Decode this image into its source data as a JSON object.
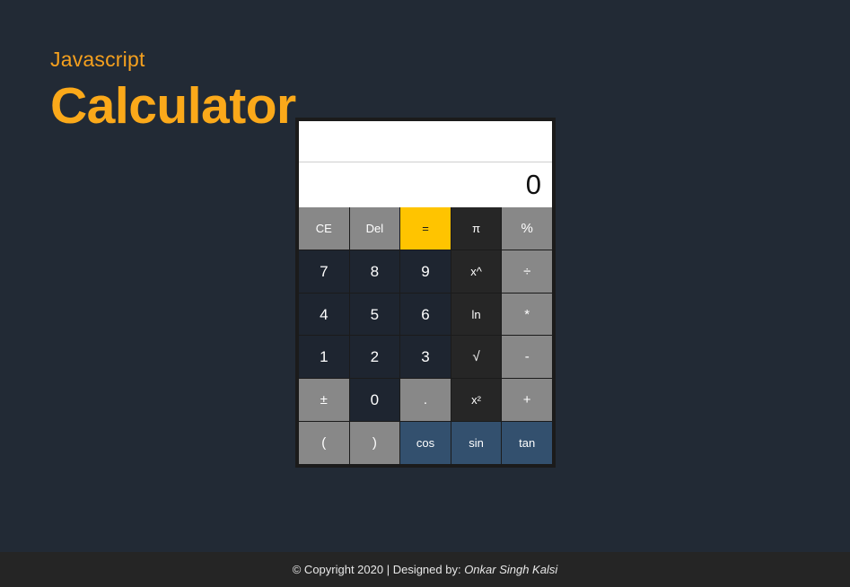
{
  "page": {
    "background_color": "#222a35",
    "subtitle": "Javascript",
    "title": "Calculator",
    "accent_color": "#fba91a"
  },
  "calculator": {
    "display": {
      "expression": "",
      "expression_placeholder": "",
      "result": "0",
      "result_placeholder": "0"
    },
    "colors": {
      "gray": "#888888",
      "yellow": "#ffc400",
      "black": "#262626",
      "navy": "#1e2530",
      "blue": "#33506e"
    },
    "keys": [
      {
        "label": "CE",
        "name": "key-clear-entry",
        "style": "k-gray",
        "size": "small"
      },
      {
        "label": "Del",
        "name": "key-delete",
        "style": "k-gray",
        "size": "small"
      },
      {
        "label": "=",
        "name": "key-equals",
        "style": "k-yellow",
        "size": "small"
      },
      {
        "label": "π",
        "name": "key-pi",
        "style": "k-black",
        "size": "small"
      },
      {
        "label": "%",
        "name": "key-percent",
        "style": "k-gray",
        "size": ""
      },
      {
        "label": "7",
        "name": "key-7",
        "style": "k-navy",
        "size": "num"
      },
      {
        "label": "8",
        "name": "key-8",
        "style": "k-navy",
        "size": "num"
      },
      {
        "label": "9",
        "name": "key-9",
        "style": "k-navy",
        "size": "num"
      },
      {
        "label": "x^",
        "name": "key-power",
        "style": "k-black",
        "size": "small"
      },
      {
        "label": "÷",
        "name": "key-divide",
        "style": "k-gray",
        "size": ""
      },
      {
        "label": "4",
        "name": "key-4",
        "style": "k-navy",
        "size": "num"
      },
      {
        "label": "5",
        "name": "key-5",
        "style": "k-navy",
        "size": "num"
      },
      {
        "label": "6",
        "name": "key-6",
        "style": "k-navy",
        "size": "num"
      },
      {
        "label": "ln",
        "name": "key-natural-log",
        "style": "k-black",
        "size": "small"
      },
      {
        "label": "*",
        "name": "key-multiply",
        "style": "k-gray",
        "size": ""
      },
      {
        "label": "1",
        "name": "key-1",
        "style": "k-navy",
        "size": "num"
      },
      {
        "label": "2",
        "name": "key-2",
        "style": "k-navy",
        "size": "num"
      },
      {
        "label": "3",
        "name": "key-3",
        "style": "k-navy",
        "size": "num"
      },
      {
        "label": "√",
        "name": "key-square-root",
        "style": "k-black",
        "size": ""
      },
      {
        "label": "-",
        "name": "key-subtract",
        "style": "k-gray",
        "size": ""
      },
      {
        "label": "±",
        "name": "key-sign-toggle",
        "style": "k-gray",
        "size": ""
      },
      {
        "label": "0",
        "name": "key-0",
        "style": "k-navy",
        "size": "num"
      },
      {
        "label": ".",
        "name": "key-decimal",
        "style": "k-gray",
        "size": ""
      },
      {
        "label": "x²",
        "name": "key-square",
        "style": "k-black",
        "size": "small"
      },
      {
        "label": "+",
        "name": "key-add",
        "style": "k-gray",
        "size": ""
      },
      {
        "label": "(",
        "name": "key-open-paren",
        "style": "k-gray",
        "size": ""
      },
      {
        "label": ")",
        "name": "key-close-paren",
        "style": "k-gray",
        "size": ""
      },
      {
        "label": "cos",
        "name": "key-cosine",
        "style": "k-blue",
        "size": "small"
      },
      {
        "label": "sin",
        "name": "key-sine",
        "style": "k-blue",
        "size": "small"
      },
      {
        "label": "tan",
        "name": "key-tangent",
        "style": "k-blue",
        "size": "small"
      }
    ]
  },
  "footer": {
    "copyright": "© Copyright 2020 | Designed by: ",
    "author": "Onkar Singh Kalsi"
  }
}
